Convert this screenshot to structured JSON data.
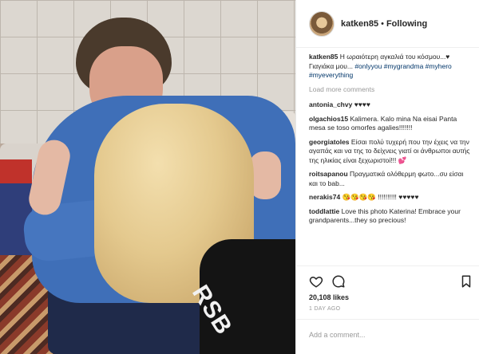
{
  "header": {
    "username": "katken85",
    "separator": "•",
    "follow_status": "Following"
  },
  "caption": {
    "username": "katken85",
    "text": "Η ωραιότερη αγκαλιά του κόσμου...♥ Γιαγιάκα μου...",
    "tags": "#onlyyou #mygrandma #myhero #myeverything"
  },
  "load_more": "Load more comments",
  "comments": [
    {
      "user": "antonia_chvy",
      "text": "♥♥♥♥"
    },
    {
      "user": "olgachios15",
      "text": "Kalimera. Kalo mina Na eisai Panta mesa se toso omorfes agalies!!!!!!!"
    },
    {
      "user": "georgiatoles",
      "text": "Είσαι πολύ τυχερή που την έχεις να την αγαπάς και να της το δείχνεις γιατί οι άνθρωποι αυτής της ηλικίας είναι ξεχωριστοί!!! 💕"
    },
    {
      "user": "roitsapanou",
      "text": "Πραγματικά ολόθερμη φωτο...συ είσαι και το bab..."
    },
    {
      "user": "nerakis74",
      "text": "😘😘😘😘 !!!!!!!!!! ♥♥♥♥♥"
    },
    {
      "user": "toddlattie",
      "text": "Love this photo Katerina! Embrace your grandparents...they so precious!"
    }
  ],
  "likes": "20,108 likes",
  "date": "1 DAY AGO",
  "add_comment_placeholder": "Add a comment...",
  "photo": {
    "print_text": "RSB"
  },
  "icons": {
    "like": "heart-icon",
    "comment": "comment-icon",
    "save": "bookmark-icon"
  },
  "colors": {
    "link": "#003569",
    "muted": "#999999",
    "text": "#262626"
  }
}
